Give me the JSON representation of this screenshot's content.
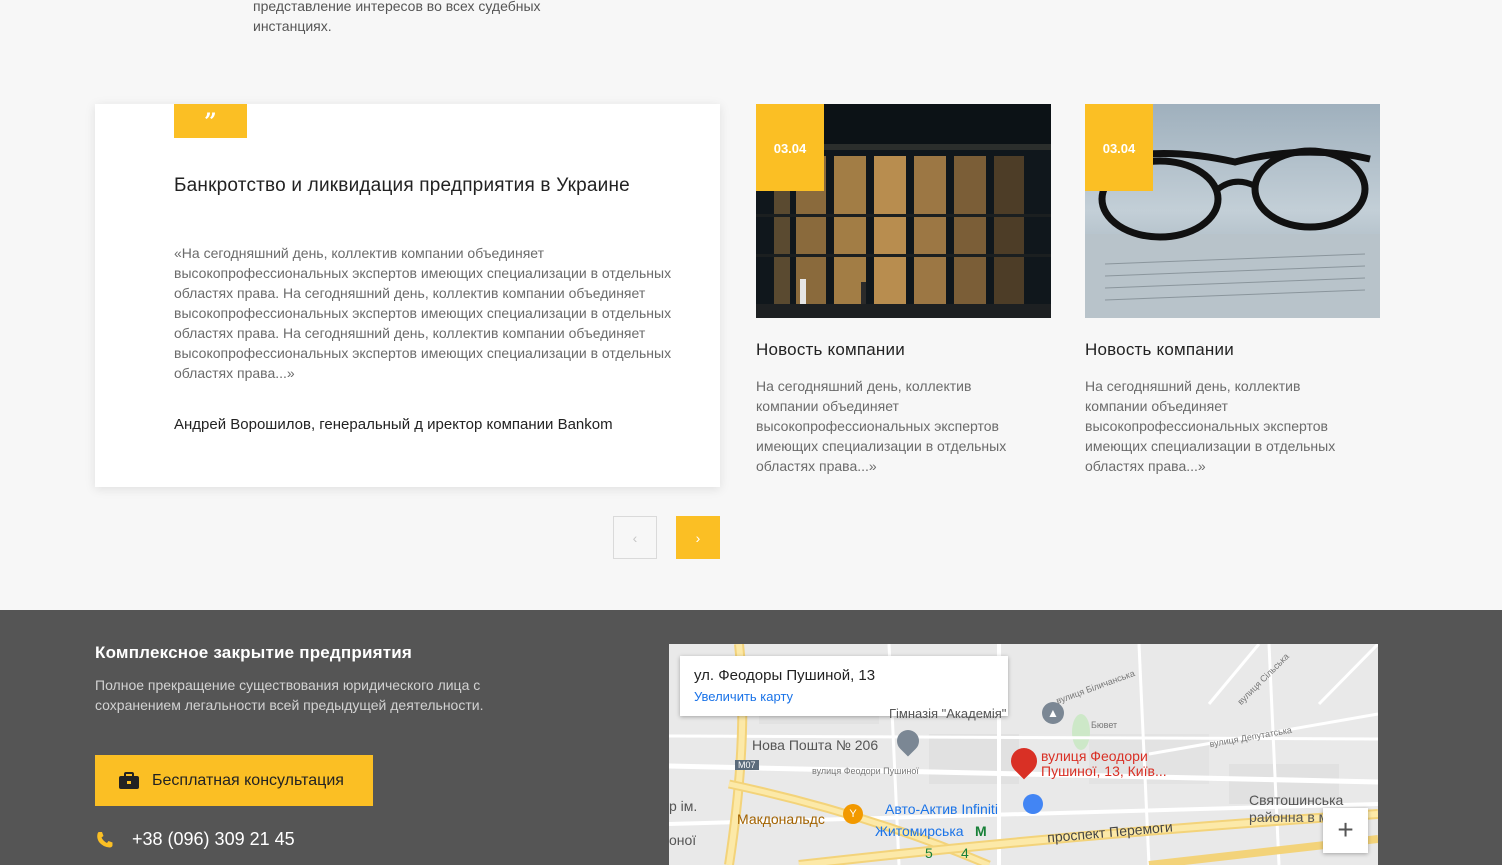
{
  "intro": {
    "text": "представление интересов во всех судебных инстанциях."
  },
  "quote": {
    "badge": "”",
    "title": "Банкротство и ликвидация предприятия в Украине",
    "text": "«На сегодняшний день, коллектив компании объединяет высокопрофессиональных экспертов имеющих специализации в отдельных областях права. На сегодняшний день, коллектив компании объединяет высокопрофессиональных экспертов имеющих специализации в отдельных областях права. На сегодняшний день, коллектив компании объединяет высокопрофессиональных экспертов имеющих специализации в отдельных областях права...»",
    "author": "Андрей Ворошилов, генеральный д иректор компании Bankom"
  },
  "news": [
    {
      "date": "03.04",
      "title": "Новость компании",
      "text": "На сегодняшний день, коллектив компании объединяет высокопрофессиональных экспертов имеющих специализации в отдельных областях права...»",
      "image": "building-photo"
    },
    {
      "date": "03.04",
      "title": "Новость компании",
      "text": "На сегодняшний день, коллектив компании объединяет высокопрофессиональных экспертов имеющих специализации в отдельных областях права...»",
      "image": "glasses-photo"
    }
  ],
  "slider": {
    "prev_icon": "‹",
    "next_icon": "›"
  },
  "footer": {
    "title": "Комплексное закрытие предприятия",
    "text": "Полное прекращение существования юридического лица с сохранением легальности всей предыдущей деятельности.",
    "consult_button": "Бесплатная консультация",
    "phone": "+38 (096) 309 21 45"
  },
  "map": {
    "address": "ул. Феодоры Пушиной, 13",
    "enlarge_link": "Увеличить карту",
    "labels": {
      "gymnasium": "Гімназія \"Академія\"",
      "nova_poshta": "Нова Пошта № 206",
      "m07": "М07",
      "street_feodory": "вулиця Феодори Пушиної",
      "pin_label": "вулиця Феодори Пушиної, 13, Київ...",
      "mcdonalds": "Макдональдс",
      "auto_aktiv": "Авто-Актив Infiniti",
      "zhytomyrska": "Житомирська",
      "metro": "M",
      "prospekt": "проспект Перемоги",
      "svyatoshynska": "Святошинська",
      "raion": "районна в місті К",
      "bilychanska": "вулиця Біличанська",
      "silska": "вулиця Сільська",
      "deputatska": "вулиця Депутатська",
      "buvet": "Бювет",
      "im": "р ім.",
      "onii": "оної",
      "num5": "5",
      "num4": "4"
    },
    "zoom_in": "+"
  },
  "colors": {
    "accent": "#fbbf24",
    "footer_bg": "#555555",
    "link": "#1a73e8",
    "pin": "#d93025"
  }
}
